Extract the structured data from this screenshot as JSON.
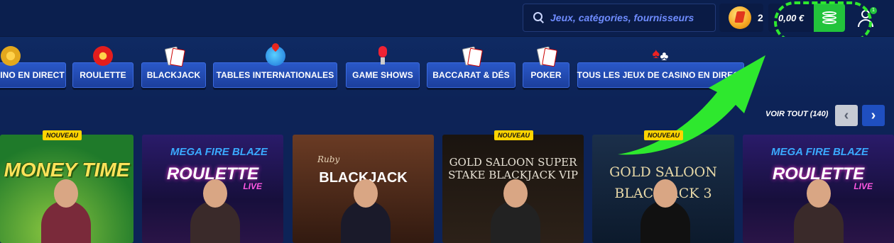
{
  "header": {
    "search_placeholder": "Jeux, catégories, fournisseurs",
    "tokens_count": "2",
    "balance": "0,00 €",
    "user_badge": "1"
  },
  "categories": [
    {
      "label": "SINO EN DIRECT",
      "icon": "dealer-icon"
    },
    {
      "label": "ROULETTE",
      "icon": "roulette-icon"
    },
    {
      "label": "BLACKJACK",
      "icon": "cards-icon"
    },
    {
      "label": "TABLES INTERNATIONALES",
      "icon": "globe-icon"
    },
    {
      "label": "GAME SHOWS",
      "icon": "microphone-icon"
    },
    {
      "label": "BACCARAT & DÉS",
      "icon": "cards-icon"
    },
    {
      "label": "POKER",
      "icon": "cards-icon"
    },
    {
      "label": "TOUS LES JEUX DE CASINO EN DIRECT",
      "icon": "chips-icon"
    }
  ],
  "section": {
    "view_all": "VOIR TOUT (140)"
  },
  "games": [
    {
      "title": "MONEY TIME",
      "badge": "NOUVEAU"
    },
    {
      "title": "ROULETTE",
      "prefix": "MEGA FIRE BLAZE",
      "suffix": "LIVE",
      "badge": ""
    },
    {
      "title": "BLACKJACK",
      "prefix": "Ruby",
      "badge": ""
    },
    {
      "title": "GOLD SALOON SUPER STAKE BLACKJACK VIP",
      "badge": "NOUVEAU"
    },
    {
      "title": "GOLD SALOON BLACKJACK 3",
      "badge": "NOUVEAU"
    },
    {
      "title": "ROULETTE",
      "prefix": "MEGA FIRE BLAZE",
      "suffix": "LIVE",
      "badge": ""
    }
  ],
  "colors": {
    "background": "#0d2357",
    "accent_green": "#22c43b",
    "button_blue": "#1f4fc0",
    "badge_yellow": "#ffd400"
  }
}
